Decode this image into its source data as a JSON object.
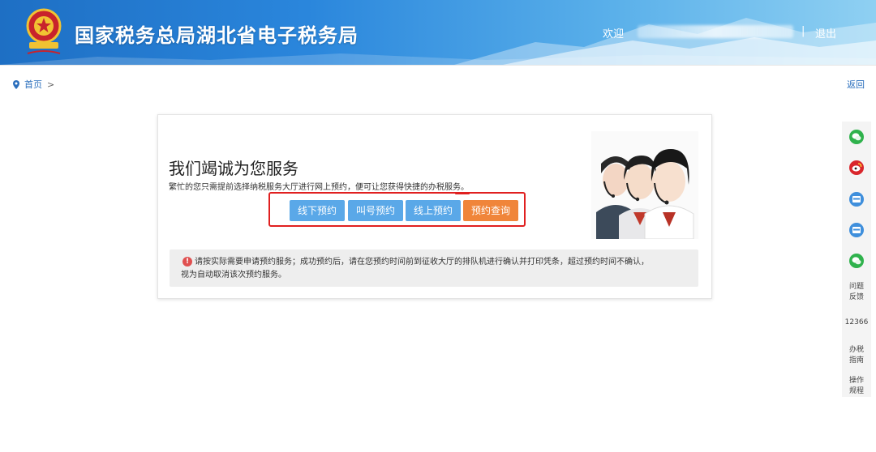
{
  "header": {
    "site_title": "国家税务总局湖北省电子税务局",
    "welcome": "欢迎",
    "divider": "|",
    "logout": "退出"
  },
  "breadcrumb": {
    "home": "首页",
    "separator": ">"
  },
  "back_link": "返回",
  "card": {
    "title": "我们竭诚为您服务",
    "description": "繁忙的您只需提前选择纳税服务大厅进行网上预约，便可让您获得快捷的办税服务。",
    "buttons": [
      {
        "label": "线下预约"
      },
      {
        "label": "叫号预约"
      },
      {
        "label": "线上预约"
      },
      {
        "label": "预约查询"
      }
    ],
    "notice_icon": "!",
    "notice_line1": "请按实际需要申请预约服务；成功预约后，请在您预约时间前到征收大厅的排队机进行确认并打印凭条，超过预约时间不确认，",
    "notice_line2": "视为自动取消该次预约服务。"
  },
  "sidebar": {
    "icons": [
      "wechat-icon",
      "weibo-icon",
      "app-icon",
      "app-icon",
      "wechat-icon"
    ],
    "feedback": "问题反馈",
    "hotline": "12366",
    "guide": "办税指南",
    "rules": "操作规程"
  },
  "colors": {
    "header_blue": "#1e6fc4",
    "button_blue": "#5aa8e8",
    "button_orange": "#f0853a",
    "highlight_red": "#e02020"
  }
}
